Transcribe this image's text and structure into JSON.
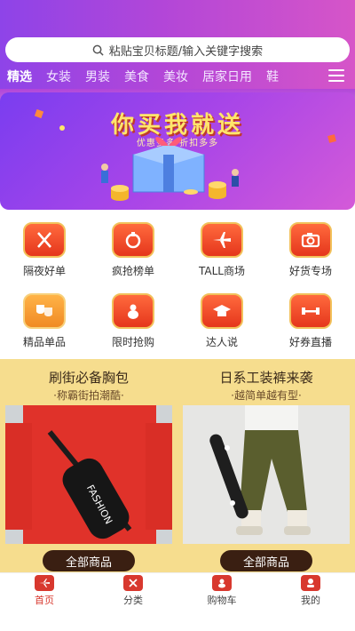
{
  "search": {
    "placeholder": "粘贴宝贝标题/输入关键字搜索"
  },
  "tabs": [
    "精选",
    "女装",
    "男装",
    "美食",
    "美妆",
    "居家日用",
    "鞋"
  ],
  "banner": {
    "title": "你买我就送",
    "subtitle": "优惠多多    折扣多多"
  },
  "grid": [
    {
      "label": "隔夜好单",
      "icon": "utensils-icon"
    },
    {
      "label": "疯抢榜单",
      "icon": "horn-icon"
    },
    {
      "label": "TALL商场",
      "icon": "airplane-icon"
    },
    {
      "label": "好货专场",
      "icon": "camera-icon"
    },
    {
      "label": "精品单品",
      "icon": "theater-masks-icon"
    },
    {
      "label": "限时抢购",
      "icon": "gourd-icon"
    },
    {
      "label": "达人说",
      "icon": "graduation-cap-icon"
    },
    {
      "label": "好券直播",
      "icon": "dumbbell-icon"
    }
  ],
  "promo": [
    {
      "title": "刷街必备胸包",
      "subtitle": "·称霸街拍潮酷·",
      "button": "全部商品",
      "image_text": "FASHION"
    },
    {
      "title": "日系工装裤来袭",
      "subtitle": "·越简单越有型·",
      "button": "全部商品"
    }
  ],
  "bottom_nav": [
    {
      "label": "首页",
      "icon": "home-icon",
      "active": true
    },
    {
      "label": "分类",
      "icon": "category-icon",
      "active": false
    },
    {
      "label": "购物车",
      "icon": "cart-icon",
      "active": false
    },
    {
      "label": "我的",
      "icon": "user-icon",
      "active": false
    }
  ],
  "colors": {
    "accent": "#d8382e",
    "header_start": "#8e44e8",
    "header_end": "#d655c8",
    "promo_bg": "#f6dd8e"
  }
}
